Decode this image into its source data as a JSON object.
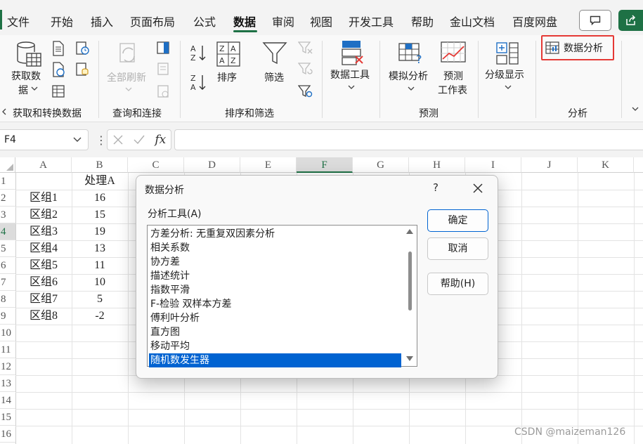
{
  "menu": {
    "tabs": [
      "文件",
      "开始",
      "插入",
      "页面布局",
      "公式",
      "数据",
      "审阅",
      "视图",
      "开发工具",
      "帮助",
      "金山文档",
      "百度网盘"
    ],
    "active": "数据"
  },
  "ribbon": {
    "get_data": "获取数",
    "get_data2": "据",
    "refresh_all": "全部刷新",
    "sort": "排序",
    "filter": "筛选",
    "data_tools": "数据工具",
    "what_if": "模拟分析",
    "forecast_line1": "预测",
    "forecast_line2": "工作表",
    "outline": "分级显示",
    "data_analysis": "数据分析",
    "groups": {
      "get_transform": "获取和转换数据",
      "queries": "查询和连接",
      "sort_filter": "排序和筛选",
      "forecast": "预测",
      "analysis": "分析"
    }
  },
  "formula_bar": {
    "name_box": "F4",
    "fx": "fx"
  },
  "sheet": {
    "columns": [
      "A",
      "B",
      "C",
      "D",
      "E",
      "F",
      "G",
      "H",
      "I",
      "J",
      "K"
    ],
    "selected_column": "F",
    "rows": [
      "1",
      "2",
      "3",
      "4",
      "5",
      "6",
      "7",
      "8",
      "9",
      "10",
      "11",
      "12",
      "13",
      "14",
      "15",
      "16"
    ],
    "selected_row": "4",
    "header_b1": "处理A",
    "data": [
      {
        "a": "区组1",
        "b": "16"
      },
      {
        "a": "区组2",
        "b": "15"
      },
      {
        "a": "区组3",
        "b": "19"
      },
      {
        "a": "区组4",
        "b": "13"
      },
      {
        "a": "区组5",
        "b": "11"
      },
      {
        "a": "区组6",
        "b": "10"
      },
      {
        "a": "区组7",
        "b": "5"
      },
      {
        "a": "区组8",
        "b": "-2"
      }
    ]
  },
  "dialog": {
    "title": "数据分析",
    "help": "?",
    "tools_label": "分析工具(A)",
    "tools": [
      "方差分析: 无重复双因素分析",
      "相关系数",
      "协方差",
      "描述统计",
      "指数平滑",
      "F-检验 双样本方差",
      "傅利叶分析",
      "直方图",
      "移动平均",
      "随机数发生器"
    ],
    "selected_tool": "随机数发生器",
    "ok": "确定",
    "cancel": "取消",
    "help_btn": "帮助(H)"
  },
  "watermark": "CSDN @maizeman126",
  "colors": {
    "accent": "#1e7145",
    "selection": "#0063d1",
    "highlight": "#e53935"
  }
}
